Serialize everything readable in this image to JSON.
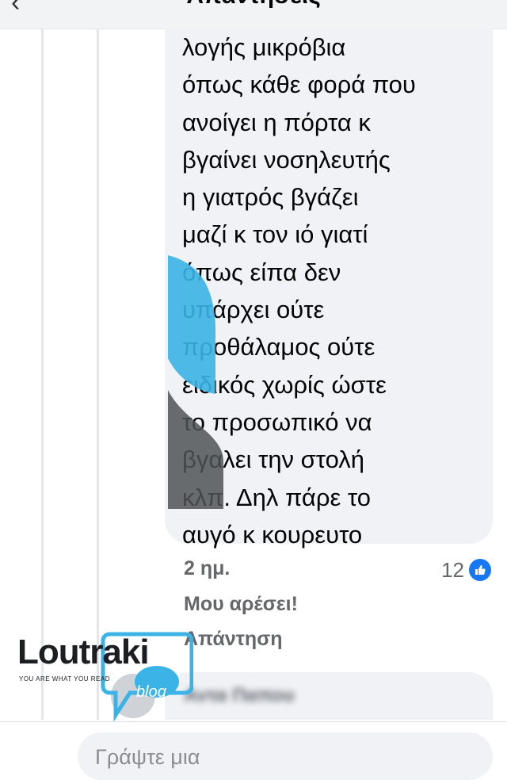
{
  "header": {
    "title": "Απαντήσεις",
    "back_glyph": "‹"
  },
  "comment": {
    "lines": [
      "λογής μικρόβια",
      "όπως κάθε φορά που",
      "ανοίγει η πόρτα κ",
      "βγαίνει νοσηλευτής",
      "η γιατρός βγάζει",
      "μαζί κ τον ιό γιατί",
      "όπως είπα δεν",
      "υπάρχει ούτε",
      "προθάλαμος ούτε",
      "ειδικός χωρίς ώστε",
      "το προσωπικό να",
      "βγαλει την στολή",
      "κλπ. Δηλ πάρε το",
      "αυγό κ κουρευτο"
    ],
    "time": "2 ημ.",
    "like_count": "12",
    "like_label": "Μου αρέσει!",
    "reply_label": "Απάντηση"
  },
  "next_reply": {
    "author": "Αντα Παπου"
  },
  "composer": {
    "placeholder": "Γράψτε μια"
  },
  "watermark": {
    "brand": "Loutraki",
    "tagline": "YOU ARE WHAT YOU READ",
    "sub": "blog"
  },
  "colors": {
    "accent": "#1877f2",
    "bubble": "#f0f2f5",
    "meta": "#65676b",
    "watermark_blue": "#3bb3e6"
  }
}
